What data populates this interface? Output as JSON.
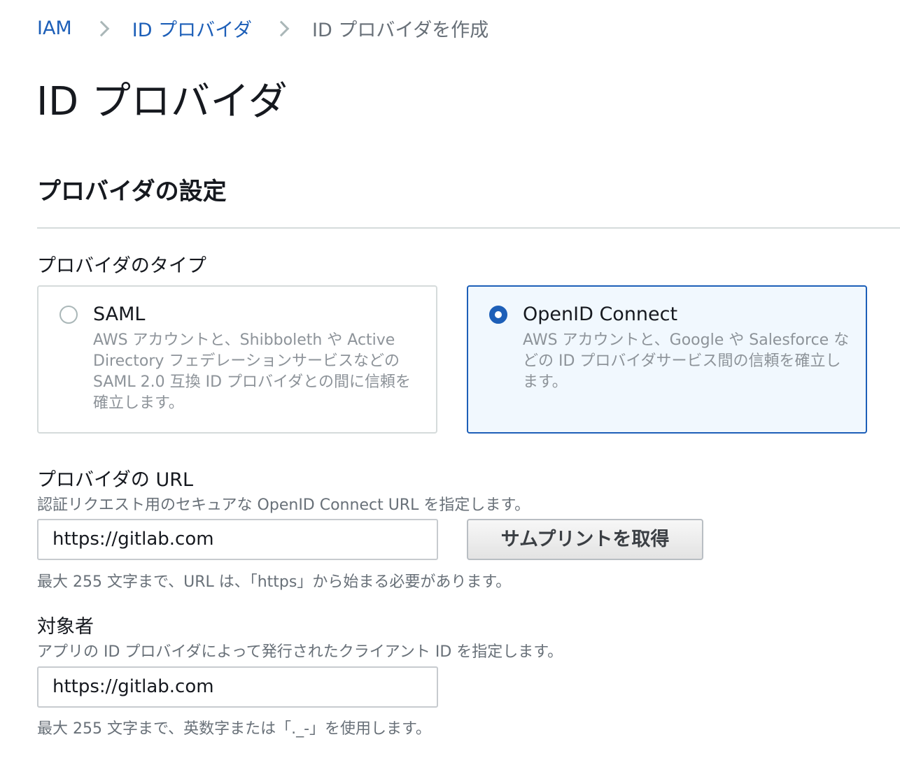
{
  "breadcrumb": {
    "items": [
      {
        "label": "IAM"
      },
      {
        "label": "ID プロバイダ"
      },
      {
        "label": "ID プロバイダを作成"
      }
    ]
  },
  "page": {
    "title": "ID プロバイダ"
  },
  "section": {
    "title": "プロバイダの設定"
  },
  "provider_type": {
    "label": "プロバイダのタイプ",
    "selected": "OpenID Connect",
    "options": [
      {
        "title": "SAML",
        "description": "AWS アカウントと、Shibboleth や Active Directory フェデレーションサービスなどの SAML 2.0 互換 ID プロバイダとの間に信頼を確立します。",
        "selected": false
      },
      {
        "title": "OpenID Connect",
        "description": "AWS アカウントと、Google や Salesforce などの ID プロバイダサービス間の信頼を確立します。",
        "selected": true
      }
    ]
  },
  "provider_url": {
    "label": "プロバイダの URL",
    "description": "認証リクエスト用のセキュアな OpenID Connect URL を指定します。",
    "value": "https://gitlab.com",
    "thumbprint_button": "サムプリントを取得",
    "hint": "最大 255 文字まで、URL は、「https」から始まる必要があります。"
  },
  "audience": {
    "label": "対象者",
    "description": "アプリの ID プロバイダによって発行されたクライアント ID を指定します。",
    "value": "https://gitlab.com",
    "hint": "最大 255 文字まで、英数字または「._-」を使用します。"
  },
  "colors": {
    "link": "#1d5fb8",
    "selected_border": "#1d5fb8",
    "selected_bg": "#f1f8fe",
    "muted_text": "#687078"
  }
}
